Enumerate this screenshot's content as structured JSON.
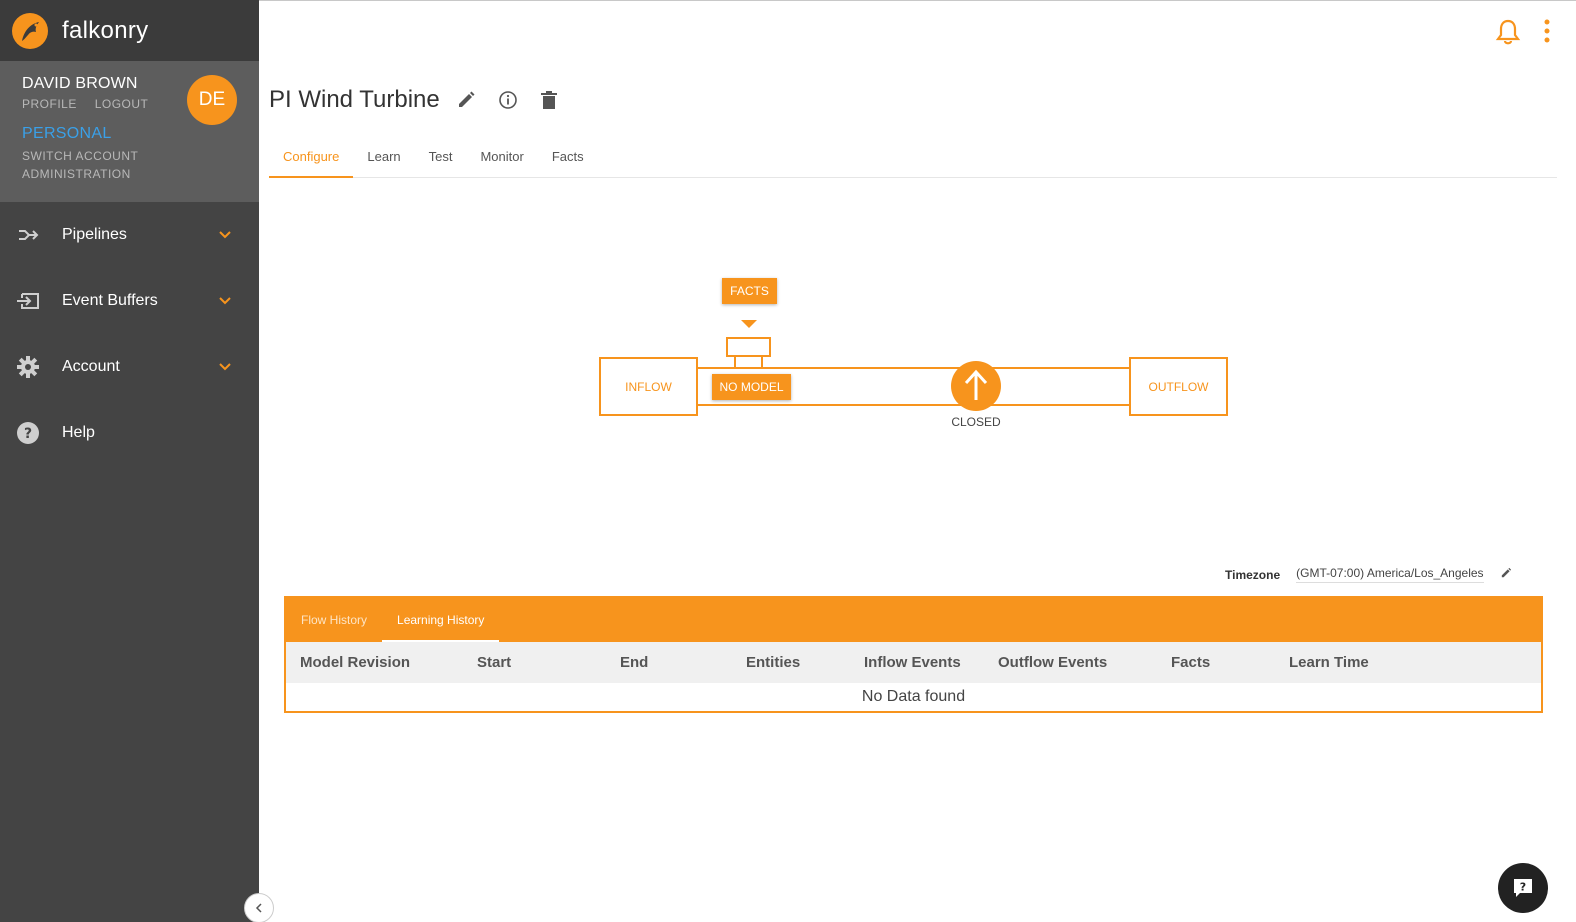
{
  "brand": {
    "name": "falkonry"
  },
  "user": {
    "name": "DAVID BROWN",
    "profile_link": "PROFILE",
    "logout_link": "LOGOUT",
    "avatar_initials": "DE",
    "account_type": "PERSONAL",
    "switch_account": "SWITCH ACCOUNT",
    "administration": "ADMINISTRATION"
  },
  "sidebar": {
    "items": [
      {
        "label": "Pipelines",
        "icon": "pipeline-icon",
        "expandable": true
      },
      {
        "label": "Event Buffers",
        "icon": "event-buffer-icon",
        "expandable": true
      },
      {
        "label": "Account",
        "icon": "gear-icon",
        "expandable": true
      },
      {
        "label": "Help",
        "icon": "help-icon",
        "expandable": false
      }
    ]
  },
  "page": {
    "title": "PI Wind Turbine"
  },
  "tabs": [
    {
      "label": "Configure",
      "active": true
    },
    {
      "label": "Learn",
      "active": false
    },
    {
      "label": "Test",
      "active": false
    },
    {
      "label": "Monitor",
      "active": false
    },
    {
      "label": "Facts",
      "active": false
    }
  ],
  "diagram": {
    "facts_label": "FACTS",
    "inflow_label": "INFLOW",
    "model_label": "NO MODEL",
    "valve_state": "CLOSED",
    "outflow_label": "OUTFLOW"
  },
  "timezone": {
    "label": "Timezone",
    "value": "(GMT-07:00) America/Los_Angeles"
  },
  "history": {
    "tabs": [
      {
        "label": "Flow History",
        "active": false
      },
      {
        "label": "Learning History",
        "active": true
      }
    ],
    "columns": [
      "Model Revision",
      "Start",
      "End",
      "Entities",
      "Inflow Events",
      "Outflow Events",
      "Facts",
      "Learn Time"
    ],
    "empty_message": "No Data found"
  },
  "colors": {
    "accent": "#f7941d",
    "sidebar": "#444444",
    "link_blue": "#3aa0e8"
  }
}
